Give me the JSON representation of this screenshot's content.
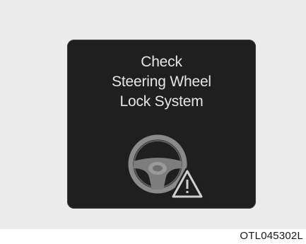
{
  "warning_display": {
    "message_lines": [
      "Check",
      "Steering Wheel",
      "Lock System"
    ],
    "icon": "steering-wheel-warning-icon"
  },
  "figure_code": "OTL045302L",
  "colors": {
    "backdrop": "#ececec",
    "panel": "#1f1f1f",
    "text": "#e6e6e6",
    "icon": "#8a8a8a"
  }
}
